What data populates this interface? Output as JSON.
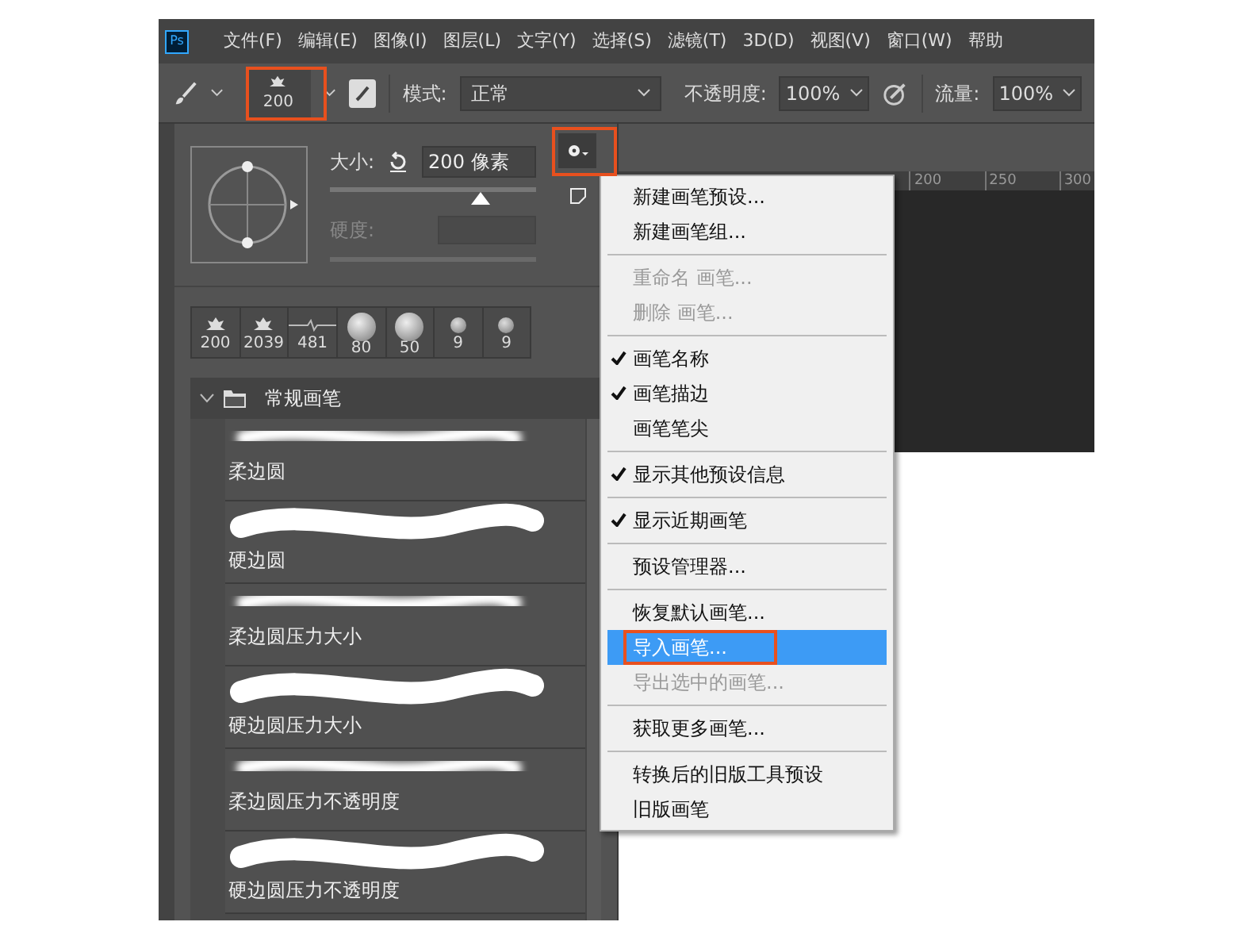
{
  "app_logo": "Ps",
  "menu_bar": [
    "文件(F)",
    "编辑(E)",
    "图像(I)",
    "图层(L)",
    "文字(Y)",
    "选择(S)",
    "滤镜(T)",
    "3D(D)",
    "视图(V)",
    "窗口(W)",
    "帮助"
  ],
  "options_bar": {
    "preset_size": "200",
    "mode_label": "模式:",
    "mode_value": "正常",
    "opacity_label": "不透明度:",
    "opacity_value": "100%",
    "flow_label": "流量:",
    "flow_value": "100%"
  },
  "brush_panel": {
    "size_label": "大小:",
    "size_value": "200 像素",
    "size_slider": {
      "level": 0.73
    },
    "hardness_label": "硬度:",
    "hardness_disabled": true,
    "recent_tips": [
      {
        "kind": "sampled",
        "label": "200"
      },
      {
        "kind": "sampled",
        "label": "2039"
      },
      {
        "kind": "line",
        "label": "481"
      },
      {
        "kind": "large",
        "label": "80"
      },
      {
        "kind": "large",
        "label": "50"
      },
      {
        "kind": "small",
        "label": "9"
      },
      {
        "kind": "small",
        "label": "9"
      }
    ],
    "group": {
      "name": "常规画笔",
      "expanded": true,
      "brushes": [
        {
          "kind": "soft",
          "name": "柔边圆"
        },
        {
          "kind": "hard",
          "name": "硬边圆"
        },
        {
          "kind": "soft",
          "name": "柔边圆压力大小"
        },
        {
          "kind": "hard",
          "name": "硬边圆压力大小"
        },
        {
          "kind": "soft",
          "name": "柔边圆压力不透明度"
        },
        {
          "kind": "hard",
          "name": "硬边圆压力不透明度"
        }
      ]
    }
  },
  "ruler": [
    "200",
    "250",
    "300"
  ],
  "context_menu": [
    [
      {
        "label": "新建画笔预设...",
        "checked": false,
        "disabled": false,
        "selected": false
      },
      {
        "label": "新建画笔组...",
        "checked": false,
        "disabled": false,
        "selected": false
      }
    ],
    [
      {
        "label": "重命名 画笔...",
        "checked": false,
        "disabled": true,
        "selected": false
      },
      {
        "label": "删除 画笔...",
        "checked": false,
        "disabled": true,
        "selected": false
      }
    ],
    [
      {
        "label": "画笔名称",
        "checked": true,
        "disabled": false,
        "selected": false
      },
      {
        "label": "画笔描边",
        "checked": true,
        "disabled": false,
        "selected": false
      },
      {
        "label": "画笔笔尖",
        "checked": false,
        "disabled": false,
        "selected": false
      }
    ],
    [
      {
        "label": "显示其他预设信息",
        "checked": true,
        "disabled": false,
        "selected": false
      }
    ],
    [
      {
        "label": "显示近期画笔",
        "checked": true,
        "disabled": false,
        "selected": false
      }
    ],
    [
      {
        "label": "预设管理器...",
        "checked": false,
        "disabled": false,
        "selected": false
      }
    ],
    [
      {
        "label": "恢复默认画笔...",
        "checked": false,
        "disabled": false,
        "selected": false
      },
      {
        "label": "导入画笔...",
        "checked": false,
        "disabled": false,
        "selected": true
      },
      {
        "label": "导出选中的画笔...",
        "checked": false,
        "disabled": true,
        "selected": false
      }
    ],
    [
      {
        "label": "获取更多画笔...",
        "checked": false,
        "disabled": false,
        "selected": false
      }
    ],
    [
      {
        "label": "转换后的旧版工具预设",
        "checked": false,
        "disabled": false,
        "selected": false
      },
      {
        "label": "旧版画笔",
        "checked": false,
        "disabled": false,
        "selected": false
      }
    ]
  ]
}
